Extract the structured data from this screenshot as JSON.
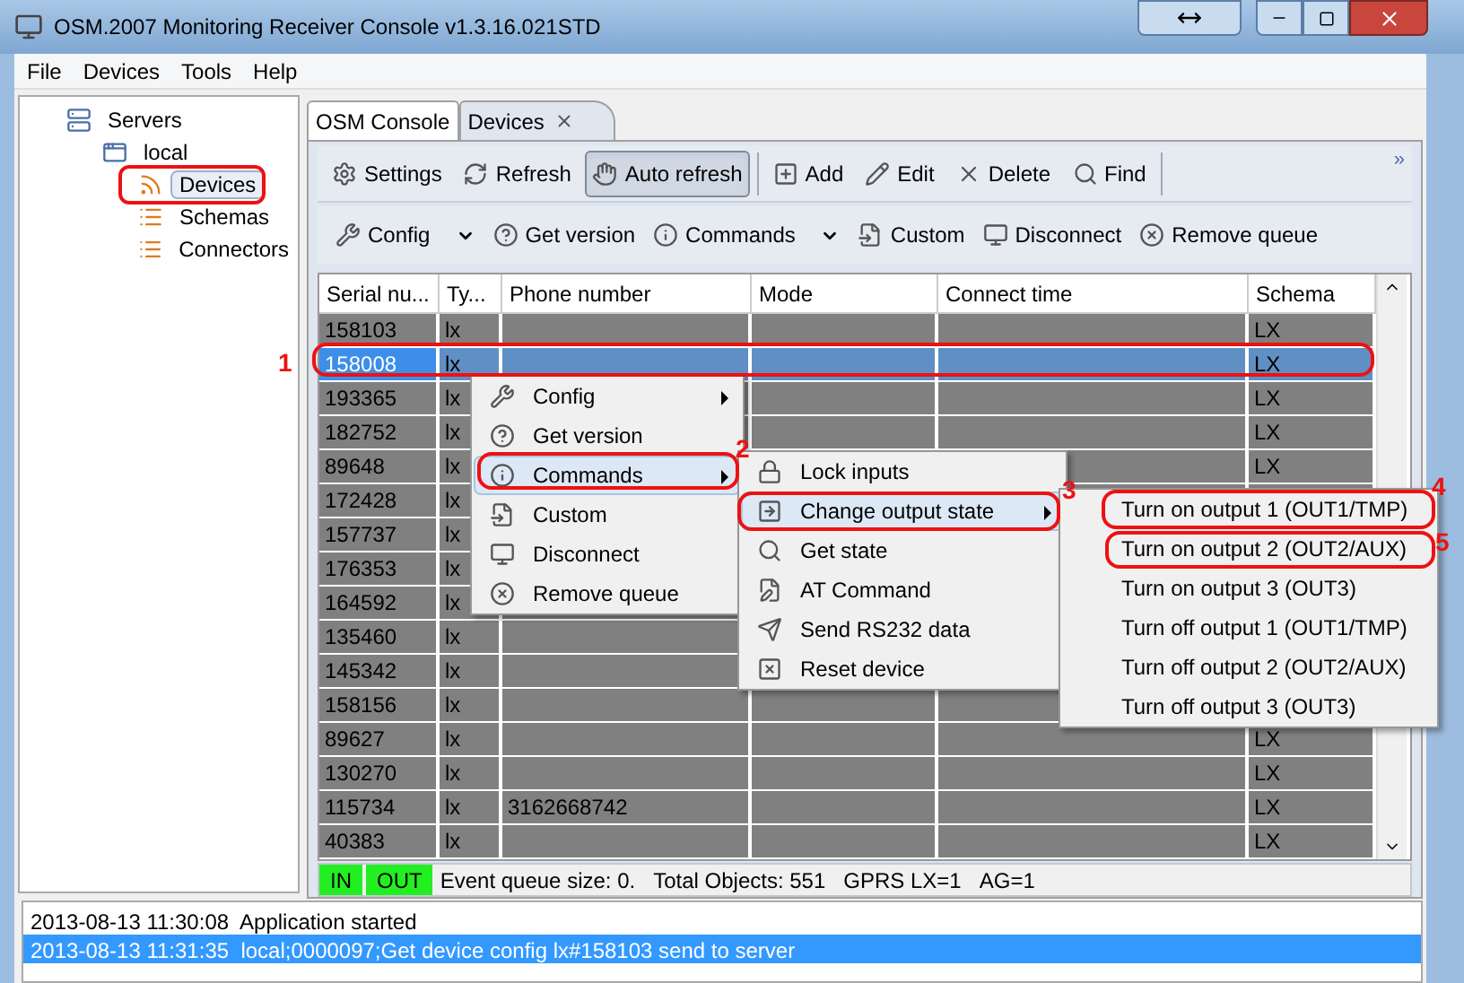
{
  "window": {
    "title": "OSM.2007 Monitoring Receiver Console v1.3.16.021STD"
  },
  "menu_bar": [
    "File",
    "Devices",
    "Tools",
    "Help"
  ],
  "tree": [
    {
      "label": "Servers",
      "selected": false,
      "children": [
        {
          "label": "local",
          "selected": false,
          "children": [
            {
              "label": "Devices",
              "selected": true
            },
            {
              "label": "Schemas",
              "selected": false
            },
            {
              "label": "Connectors",
              "selected": false
            }
          ]
        }
      ]
    }
  ],
  "tabs": [
    {
      "label": "OSM Console",
      "selected": false,
      "closable": false
    },
    {
      "label": "Devices",
      "selected": true,
      "closable": true
    }
  ],
  "toolbar_1": [
    {
      "label": "Settings",
      "pressed": false
    },
    {
      "label": "Refresh",
      "pressed": false
    },
    {
      "label": "Auto refresh",
      "pressed": true
    },
    {
      "label": "Add",
      "pressed": false
    },
    {
      "label": "Edit",
      "pressed": false
    },
    {
      "label": "Delete",
      "pressed": false
    },
    {
      "label": "Find",
      "pressed": false
    }
  ],
  "toolbar_overflow": "»",
  "toolbar_2": [
    {
      "label": "Config",
      "dropdown": true
    },
    {
      "label": "Get version",
      "dropdown": false
    },
    {
      "label": "Commands",
      "dropdown": true
    },
    {
      "label": "Custom",
      "dropdown": false
    },
    {
      "label": "Disconnect",
      "dropdown": false
    },
    {
      "label": "Remove queue",
      "dropdown": false
    }
  ],
  "table": {
    "columns": [
      "Serial nu...",
      "Ty...",
      "Phone number",
      "Mode",
      "Connect time",
      "Schema"
    ],
    "rows": [
      {
        "serial": "158103",
        "type": "lx",
        "schema": "LX",
        "selected": false
      },
      {
        "serial": "158008",
        "type": "lx",
        "schema": "LX",
        "selected": true
      },
      {
        "serial": "193365",
        "type": "lx",
        "schema": "LX",
        "selected": false
      },
      {
        "serial": "182752",
        "type": "lx",
        "schema": "LX",
        "selected": false
      },
      {
        "serial": "89648",
        "type": "lx",
        "schema": "LX",
        "selected": false
      },
      {
        "serial": "172428",
        "type": "lx",
        "selected": false
      },
      {
        "serial": "157737",
        "type": "lx",
        "selected": false
      },
      {
        "serial": "176353",
        "type": "lx",
        "selected": false
      },
      {
        "serial": "164592",
        "type": "lx",
        "selected": false
      },
      {
        "serial": "135460",
        "type": "lx",
        "selected": false
      },
      {
        "serial": "145342",
        "type": "lx",
        "selected": false
      },
      {
        "serial": "158156",
        "type": "lx",
        "selected": false
      },
      {
        "serial": "89627",
        "type": "lx",
        "schema": "LX",
        "selected": false
      },
      {
        "serial": "130270",
        "type": "lx",
        "schema": "LX",
        "selected": false
      },
      {
        "serial": "115734",
        "type": "lx",
        "phone": "3162668742",
        "schema": "LX",
        "selected": false
      },
      {
        "serial": "40383",
        "type": "lx",
        "schema": "LX",
        "selected": false
      }
    ]
  },
  "status_bar": {
    "indicators": [
      "IN",
      "OUT"
    ],
    "texts": [
      "Event queue size: 0.",
      "Total Objects: 551",
      "GPRS LX=1",
      "AG=1"
    ]
  },
  "log": [
    {
      "text": "2013-08-13 11:30:08  Application started",
      "selected": false
    },
    {
      "text": "2013-08-13 11:31:35  local;0000097;Get device config lx#158103 send to server",
      "selected": true
    }
  ],
  "context_menu": [
    {
      "label": "Config",
      "submenu": true,
      "selected": false
    },
    {
      "label": "Get version",
      "submenu": false,
      "selected": false
    },
    {
      "label": "Commands",
      "submenu": true,
      "selected": true
    },
    {
      "label": "Custom",
      "submenu": false,
      "selected": false
    },
    {
      "label": "Disconnect",
      "submenu": false,
      "selected": false
    },
    {
      "label": "Remove queue",
      "submenu": false,
      "selected": false
    }
  ],
  "commands_menu": [
    {
      "label": "Lock inputs",
      "submenu": false,
      "selected": false
    },
    {
      "label": "Change output state",
      "submenu": true,
      "selected": true
    },
    {
      "label": "Get state",
      "submenu": false,
      "selected": false
    },
    {
      "label": "AT Command",
      "submenu": false,
      "selected": false
    },
    {
      "label": "Send RS232 data",
      "submenu": false,
      "selected": false
    },
    {
      "label": "Reset device",
      "submenu": false,
      "selected": false
    }
  ],
  "output_menu": [
    {
      "label": "Turn on output 1 (OUT1/TMP)",
      "selected": false
    },
    {
      "label": "Turn on output 2 (OUT2/AUX)",
      "selected": false
    },
    {
      "label": "Turn on output 3 (OUT3)",
      "selected": false
    },
    {
      "label": "Turn off output 1 (OUT1/TMP)",
      "selected": false
    },
    {
      "label": "Turn off output 2 (OUT2/AUX)",
      "selected": false
    },
    {
      "label": "Turn off output 3 (OUT3)",
      "selected": false
    }
  ],
  "annotations": [
    "1",
    "2",
    "3",
    "4",
    "5"
  ]
}
